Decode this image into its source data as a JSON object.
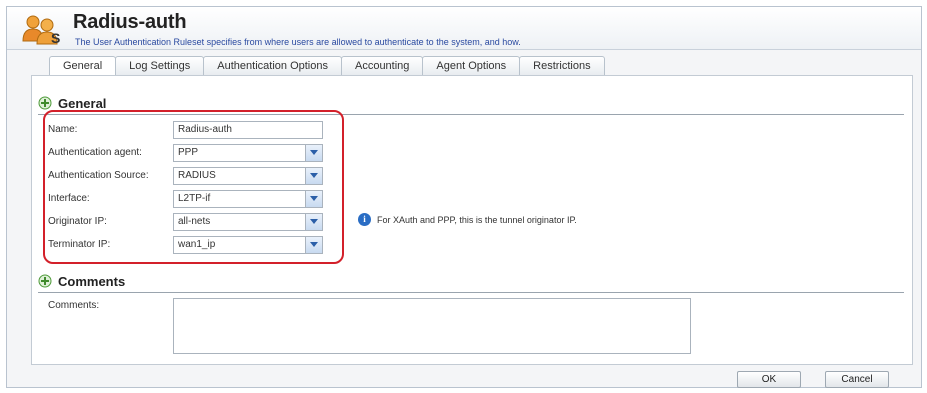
{
  "header": {
    "title": "Radius-auth",
    "subtitle": "The User Authentication Ruleset specifies from where users are allowed to authenticate to the system, and how."
  },
  "tabs": [
    {
      "label": "General",
      "active": true
    },
    {
      "label": "Log Settings",
      "active": false
    },
    {
      "label": "Authentication Options",
      "active": false
    },
    {
      "label": "Accounting",
      "active": false
    },
    {
      "label": "Agent Options",
      "active": false
    },
    {
      "label": "Restrictions",
      "active": false
    }
  ],
  "general": {
    "section_title": "General",
    "fields": [
      {
        "label": "Name:",
        "value": "Radius-auth",
        "type": "text"
      },
      {
        "label": "Authentication agent:",
        "value": "PPP",
        "type": "select"
      },
      {
        "label": "Authentication Source:",
        "value": "RADIUS",
        "type": "select"
      },
      {
        "label": "Interface:",
        "value": "L2TP-if",
        "type": "select"
      },
      {
        "label": "Originator IP:",
        "value": "all-nets",
        "type": "select"
      },
      {
        "label": "Terminator IP:",
        "value": "wan1_ip",
        "type": "select"
      }
    ],
    "info_text": "For XAuth and PPP, this is the tunnel originator IP."
  },
  "comments": {
    "section_title": "Comments",
    "label": "Comments:",
    "value": ""
  },
  "buttons": {
    "ok": "OK",
    "cancel": "Cancel"
  },
  "colors": {
    "highlight": "#d3202a",
    "info": "#2a6dc4",
    "subtitle": "#2a4aa0"
  }
}
